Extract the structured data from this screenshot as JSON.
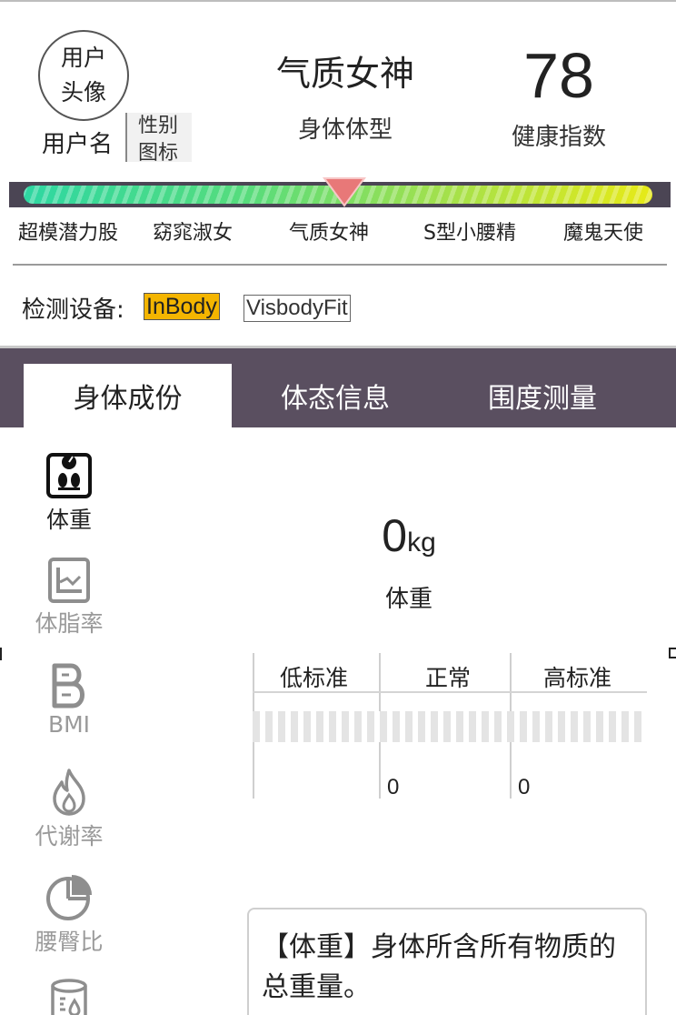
{
  "header": {
    "avatar_line1": "用户",
    "avatar_line2": "头像",
    "username": "用户名",
    "gender_icon_line1": "性别",
    "gender_icon_line2": "图标",
    "body_type_name": "气质女神",
    "body_type_label": "身体体型",
    "health_score": "78",
    "health_score_label": "健康指数"
  },
  "gauge": {
    "pointer_position_pct": 51,
    "labels": [
      "超模潜力股",
      "窈窕淑女",
      "气质女神",
      "S型小腰精",
      "魔鬼天使"
    ],
    "colors": {
      "start": "#2ed7a2",
      "end": "#e7ea17",
      "pointer": "#e87878"
    }
  },
  "device": {
    "label": "检测设备:",
    "options": [
      "InBody",
      "VisbodyFit"
    ],
    "selected": "InBody",
    "selected_color": "#f4b500"
  },
  "tabs": {
    "items": [
      "身体成份",
      "体态信息",
      "围度测量"
    ],
    "active": "身体成份",
    "bar_color": "#5a4f60"
  },
  "sidebar": {
    "items": [
      {
        "label": "体重",
        "icon": "scale-icon",
        "active": true
      },
      {
        "label": "体脂率",
        "icon": "line-chart-icon",
        "active": false
      },
      {
        "label": "BMI",
        "icon": "bmi-icon",
        "active": false
      },
      {
        "label": "代谢率",
        "icon": "flame-icon",
        "active": false
      },
      {
        "label": "腰臀比",
        "icon": "pie-chart-icon",
        "active": false
      },
      {
        "label": "",
        "icon": "water-cylinder-icon",
        "active": false
      }
    ]
  },
  "metric": {
    "value": "0",
    "unit": "kg",
    "label": "体重"
  },
  "range": {
    "headers": [
      "低标准",
      "正常",
      "高标准"
    ],
    "bounds": [
      "0",
      "0"
    ]
  },
  "description": {
    "text": "【体重】身体所含所有物质的总重量。"
  }
}
